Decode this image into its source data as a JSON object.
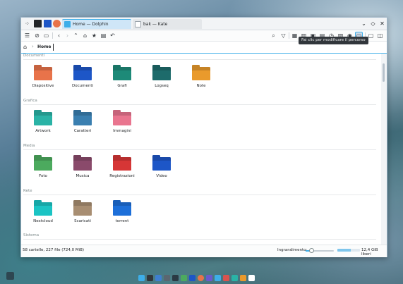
{
  "window": {
    "tabs": [
      {
        "label": "Home — Dolphin",
        "active": true
      },
      {
        "label": "bak — Kate",
        "active": false
      }
    ],
    "controls": [
      "chevron-down-icon",
      "diamond-icon",
      "close-icon"
    ]
  },
  "toolbar": {
    "left": [
      "menu-icon",
      "places-icon",
      "split-icon",
      "back-icon",
      "forward-icon",
      "up-icon",
      "home-icon",
      "bookmark-icon",
      "new-folder-icon",
      "undo-icon"
    ],
    "right": [
      "search-icon",
      "filter-icon",
      "icons-view-icon",
      "compact-view-icon",
      "details-view-icon",
      "preview-icon",
      "recent-icon",
      "image-icon",
      "hidden-files-icon",
      "location-bar-icon",
      "terminal-icon",
      "sidebar-icon"
    ]
  },
  "location": {
    "path": "Home"
  },
  "tooltip": "Fai clic per modificare il percorso",
  "groups": [
    {
      "name": "Documenti",
      "items": [
        {
          "label": "Diapositive",
          "color": "#e8734a"
        },
        {
          "label": "Documenti",
          "color": "#1d56c7"
        },
        {
          "label": "Grafi",
          "color": "#1d8a78"
        },
        {
          "label": "Logseq",
          "color": "#1d6b6b"
        },
        {
          "label": "Note",
          "color": "#e99a2c"
        }
      ]
    },
    {
      "name": "Grafica",
      "items": [
        {
          "label": "Artwork",
          "color": "#2ab3a6"
        },
        {
          "label": "Caratteri",
          "color": "#3a7fb0"
        },
        {
          "label": "Immagini",
          "color": "#e9758f"
        }
      ]
    },
    {
      "name": "Media",
      "items": [
        {
          "label": "Foto",
          "color": "#4caa5e"
        },
        {
          "label": "Musica",
          "color": "#8a4a6b"
        },
        {
          "label": "Registrazioni",
          "color": "#d63636"
        },
        {
          "label": "Video",
          "color": "#1d56c7"
        }
      ]
    },
    {
      "name": "Rete",
      "items": [
        {
          "label": "Nextcloud",
          "color": "#1bc4c4"
        },
        {
          "label": "Scaricati",
          "color": "#a88e72"
        },
        {
          "label": "torrent",
          "color": "#1d6fd9"
        }
      ]
    },
    {
      "name": "Sistema",
      "items": []
    }
  ],
  "status": {
    "summary": "58 cartelle, 227 file (724,0 MiB)",
    "zoom_label": "Ingrandimento:",
    "zoom_level": 0.2,
    "free_label": "12,4 GiB liberi",
    "disk_used": 0.6
  },
  "colors": {
    "accent": "#3daee9",
    "tab_active": "#cfe6f7"
  }
}
